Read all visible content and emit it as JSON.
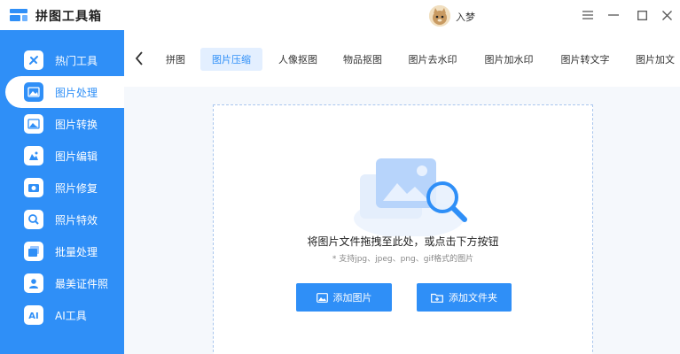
{
  "app": {
    "title": "拼图工具箱",
    "logo_icon": "app-logo-icon"
  },
  "user": {
    "name": "入梦",
    "avatar_icon": "cat-avatar"
  },
  "window_controls": [
    {
      "name": "menu-icon"
    },
    {
      "name": "minimize-icon"
    },
    {
      "name": "maximize-icon"
    },
    {
      "name": "close-icon"
    }
  ],
  "sidebar": {
    "items": [
      {
        "label": "热门工具",
        "icon": "hot-tools-icon",
        "active": false
      },
      {
        "label": "图片处理",
        "icon": "image-process-icon",
        "active": true
      },
      {
        "label": "图片转换",
        "icon": "image-convert-icon",
        "active": false
      },
      {
        "label": "图片编辑",
        "icon": "image-edit-icon",
        "active": false
      },
      {
        "label": "照片修复",
        "icon": "photo-repair-icon",
        "active": false
      },
      {
        "label": "照片特效",
        "icon": "photo-effect-icon",
        "active": false
      },
      {
        "label": "批量处理",
        "icon": "batch-process-icon",
        "active": false
      },
      {
        "label": "最美证件照",
        "icon": "id-photo-icon",
        "active": false
      },
      {
        "label": "AI工具",
        "icon": "ai-tools-icon",
        "active": false
      }
    ]
  },
  "tabs": [
    {
      "label": "拼图",
      "active": false
    },
    {
      "label": "图片压缩",
      "active": true
    },
    {
      "label": "人像抠图",
      "active": false
    },
    {
      "label": "物品抠图",
      "active": false
    },
    {
      "label": "图片去水印",
      "active": false
    },
    {
      "label": "图片加水印",
      "active": false
    },
    {
      "label": "图片转文字",
      "active": false
    },
    {
      "label": "图片加文",
      "active": false
    }
  ],
  "dropzone": {
    "title": "将图片文件拖拽至此处，或点击下方按钮",
    "subtitle": "* 支持jpg、jpeg、png、gif格式的图片",
    "add_image_label": "添加图片",
    "add_folder_label": "添加文件夹"
  },
  "colors": {
    "accent": "#2f8ff7",
    "active_tab_bg": "#e3efff",
    "main_bg": "#f5f8fc"
  }
}
